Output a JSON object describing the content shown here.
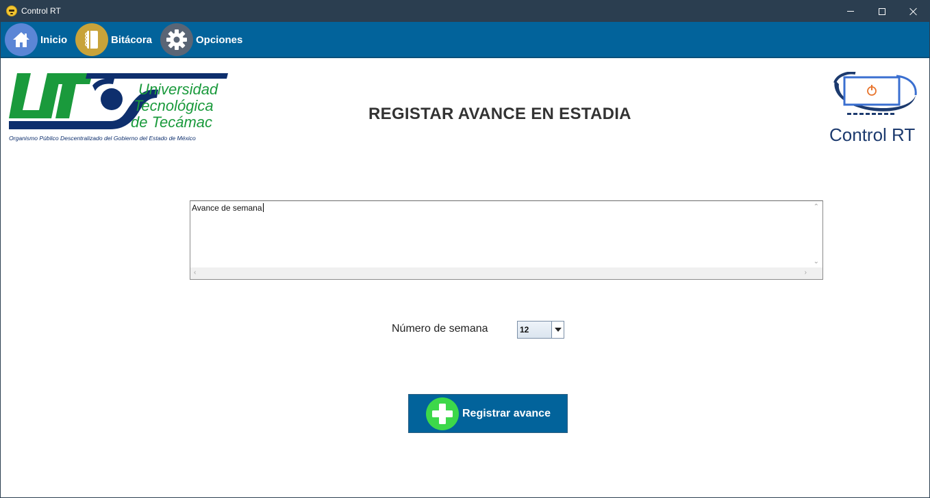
{
  "window": {
    "title": "Control RT"
  },
  "nav": {
    "items": [
      {
        "label": "Inicio",
        "icon": "home-icon"
      },
      {
        "label": "Bitácora",
        "icon": "notebook-icon"
      },
      {
        "label": "Opciones",
        "icon": "gear-icon"
      }
    ]
  },
  "header": {
    "title": "REGISTAR AVANCE EN ESTADIA",
    "logo_ut": {
      "line1": "Universidad",
      "line2": "Tecnológica",
      "line3": "de Tecámac",
      "subtitle": "Organismo Público Descentralizado del Gobierno del Estado de México"
    },
    "logo_crt": {
      "text": "Control RT"
    }
  },
  "form": {
    "textarea_value": "Avance de semana",
    "week_label": "Número de semana",
    "week_value": "12",
    "register_label": "Registrar avance"
  },
  "colors": {
    "titlebar": "#2b3e50",
    "navbar": "#02639b",
    "ut_green": "#1a9a3c",
    "ut_blue": "#0e2f6d",
    "button": "#02639b",
    "plus_green": "#3dd84a"
  }
}
